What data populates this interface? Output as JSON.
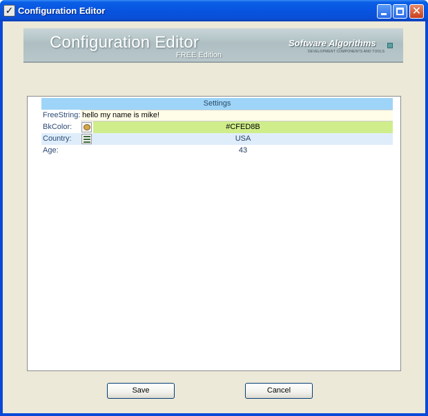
{
  "window": {
    "title": "Configuration Editor",
    "icon": "checkmark-icon",
    "controls": {
      "minimize": "minimize-icon",
      "maximize": "maximize-icon",
      "close": "close-icon"
    }
  },
  "banner": {
    "title": "Configuration Editor",
    "edition": "FREE Edition",
    "brand": "Software Algorithms",
    "brand_tagline": "DEVELOPMENT COMPONENTS AND TOOLS"
  },
  "property_grid": {
    "header": "Settings",
    "rows": [
      {
        "label": "FreeString:",
        "value": "hello my name is mike!"
      },
      {
        "label": "BkColor:",
        "value": "#CFED8B",
        "icon": "palette-icon",
        "swatch_color": "#CFED8B"
      },
      {
        "label": "Country:",
        "value": "USA",
        "icon": "list-icon"
      },
      {
        "label": "Age:",
        "value": "43"
      }
    ]
  },
  "buttons": {
    "save": "Save",
    "cancel": "Cancel"
  },
  "colors": {
    "titlebar": "#0754E0",
    "window_background": "#ECE9D8",
    "grid_header": "#9ED4F8",
    "selected_row": "#DFEDFB"
  }
}
